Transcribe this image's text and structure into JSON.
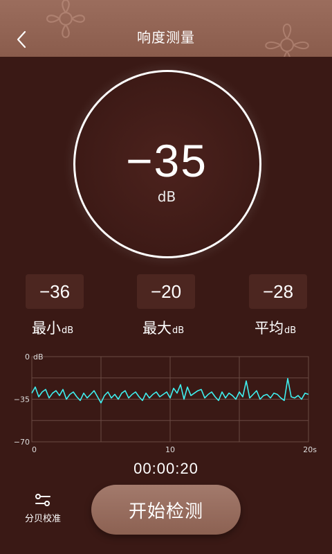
{
  "header": {
    "title": "响度测量"
  },
  "meter": {
    "value": "−35",
    "unit": "dB"
  },
  "stats": [
    {
      "value": "−36",
      "label": "最小",
      "unit": "dB"
    },
    {
      "value": "−20",
      "label": "最大",
      "unit": "dB"
    },
    {
      "value": "−28",
      "label": "平均",
      "unit": "dB"
    }
  ],
  "chart_data": {
    "type": "line",
    "ylim": [
      -70,
      0
    ],
    "xlim": [
      0,
      20
    ],
    "y_ticks": [
      "0",
      "−35",
      "−70"
    ],
    "y_unit": "dB",
    "x_ticks": [
      "0",
      "10",
      "20s"
    ],
    "series_color": "#3ff0f0",
    "x": [
      0,
      0.25,
      0.5,
      0.75,
      1,
      1.25,
      1.5,
      1.75,
      2,
      2.25,
      2.5,
      2.75,
      3,
      3.25,
      3.5,
      3.75,
      4,
      4.25,
      4.5,
      4.75,
      5,
      5.25,
      5.5,
      5.75,
      6,
      6.25,
      6.5,
      6.75,
      7,
      7.25,
      7.5,
      7.75,
      8,
      8.25,
      8.5,
      8.75,
      9,
      9.25,
      9.5,
      9.75,
      10,
      10.25,
      10.5,
      10.75,
      11,
      11.25,
      11.5,
      11.75,
      12,
      12.25,
      12.5,
      12.75,
      13,
      13.25,
      13.5,
      13.75,
      14,
      14.25,
      14.5,
      14.75,
      15,
      15.25,
      15.5,
      15.75,
      16,
      16.25,
      16.5,
      16.75,
      17,
      17.25,
      17.5,
      17.75,
      18,
      18.25,
      18.5,
      18.75,
      19,
      19.25,
      19.5,
      19.75,
      20
    ],
    "y": [
      -30,
      -25,
      -33,
      -29,
      -27,
      -34,
      -30,
      -28,
      -32,
      -27,
      -35,
      -31,
      -29,
      -33,
      -36,
      -30,
      -34,
      -31,
      -28,
      -33,
      -38,
      -32,
      -29,
      -34,
      -31,
      -35,
      -30,
      -28,
      -34,
      -31,
      -29,
      -33,
      -36,
      -30,
      -34,
      -31,
      -29,
      -33,
      -31,
      -29,
      -34,
      -26,
      -30,
      -23,
      -35,
      -25,
      -32,
      -30,
      -28,
      -27,
      -34,
      -31,
      -29,
      -33,
      -36,
      -29,
      -34,
      -30,
      -32,
      -35,
      -29,
      -33,
      -20,
      -34,
      -31,
      -28,
      -35,
      -32,
      -31,
      -34,
      -30,
      -31,
      -34,
      -36,
      -18,
      -33,
      -34,
      -32,
      -35,
      -30,
      -31,
      -34,
      -33,
      -30,
      -22,
      -36,
      -32,
      -37
    ]
  },
  "timer": "00:00:20",
  "calibrate": {
    "label": "分贝校准"
  },
  "start": {
    "label": "开始检测"
  },
  "colors": {
    "background": "#3a1915",
    "header": "#8a5c4c",
    "accent": "#3ff0f0",
    "button": "#9a6f61"
  }
}
